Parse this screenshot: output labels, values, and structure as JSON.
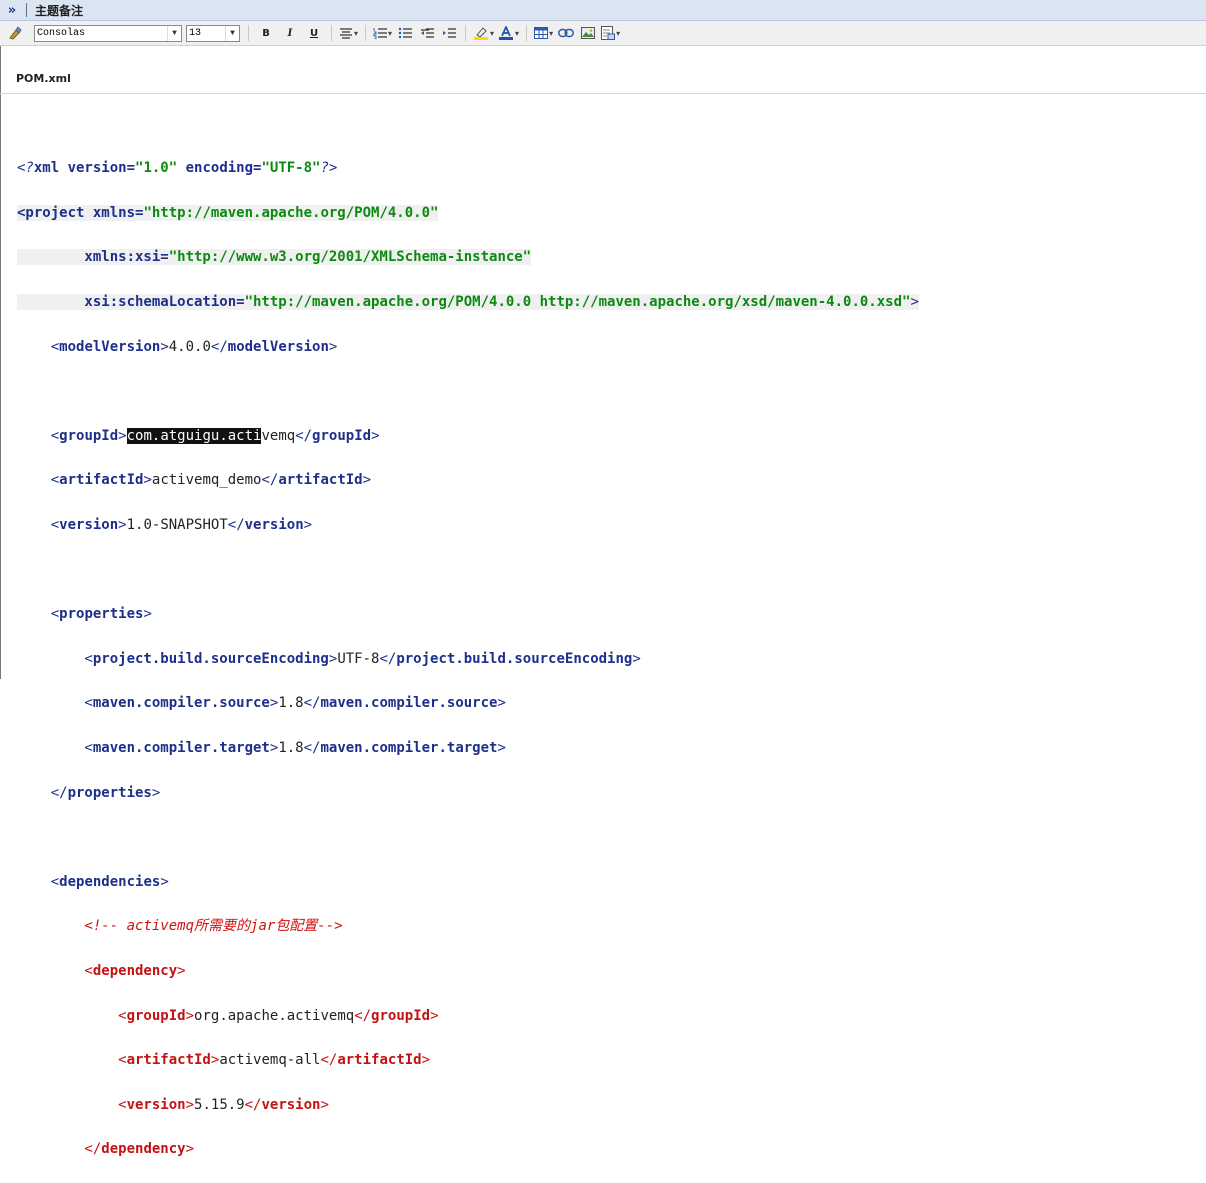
{
  "title_bar": {
    "expand_icon": "»",
    "title": "主题备注"
  },
  "toolbar": {
    "font_family": "Consolas",
    "font_size": "13",
    "bold": "B",
    "italic": "I",
    "underline": "U"
  },
  "document": {
    "name": "POM.xml"
  },
  "code": {
    "l1a": "<?",
    "l1b": "xml version=",
    "l1c": "\"1.0\"",
    "l1d": " encoding=",
    "l1e": "\"UTF-8\"",
    "l1f": "?>",
    "l2a": "<project ",
    "l2b": "xmlns=",
    "l2c": "\"http://maven.apache.org/POM/4.0.0\"",
    "l3a": "        xmlns:xsi=",
    "l3b": "\"http://www.w3.org/2001/XMLSchema-instance\"",
    "l4a": "        xsi:schemaLocation=",
    "l4b": "\"http://maven.apache.org/POM/4.0.0 http://maven.apache.org/xsd/maven-4.0.0.xsd\"",
    "l4c": ">",
    "modelVersion": "4.0.0",
    "groupId_selected": "com.atguigu.acti",
    "groupId_rest": "vemq",
    "artifactId": "activemq_demo",
    "version": "1.0-SNAPSHOT",
    "sourceEncoding": "UTF-8",
    "compiler_source": "1.8",
    "compiler_target": "1.8",
    "comment": "<!-- activemq所需要的jar包配置-->",
    "dep_groupId": "org.apache.activemq",
    "dep_artifactId": "activemq-all",
    "dep_version": "5.15.9"
  }
}
